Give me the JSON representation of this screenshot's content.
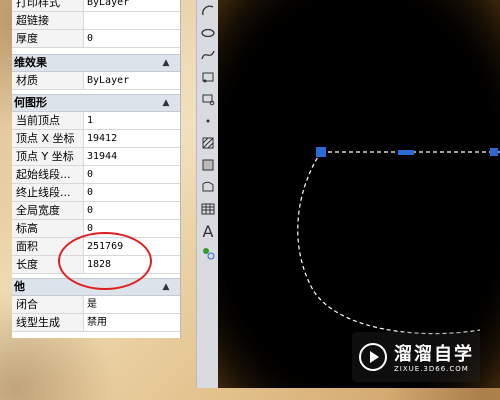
{
  "properties_panel": {
    "rows_top": [
      {
        "label": "打印样式",
        "value": "ByLayer",
        "label_display": "打印样式"
      },
      {
        "label": "超链接",
        "value": ""
      },
      {
        "label": "厚度",
        "value": "0"
      }
    ],
    "section_3d": {
      "title": "三维效果",
      "title_display": "维效果",
      "rows": [
        {
          "label": "材质",
          "value": "ByLayer"
        }
      ]
    },
    "section_geometry": {
      "title": "几何图形",
      "title_display": "何图形",
      "rows": [
        {
          "label": "当前顶点",
          "value": "1"
        },
        {
          "label": "顶点 X 坐标",
          "value": "19412"
        },
        {
          "label": "顶点 Y 坐标",
          "value": "31944"
        },
        {
          "label": "起始线段...",
          "value": "0"
        },
        {
          "label": "终止线段...",
          "value": "0"
        },
        {
          "label": "全局宽度",
          "value": "0"
        },
        {
          "label": "标高",
          "value": "0"
        },
        {
          "label": "面积",
          "value": "251769"
        },
        {
          "label": "长度",
          "value": "1828"
        }
      ]
    },
    "section_other": {
      "title": "其他",
      "title_display": "他",
      "rows": [
        {
          "label": "闭合",
          "value": "是"
        },
        {
          "label": "线型生成",
          "value": "禁用"
        }
      ]
    }
  },
  "toolbar": {
    "tools": [
      "arc-icon",
      "ellipse-icon",
      "spline-icon",
      "insert-block-icon",
      "make-block-icon",
      "point-icon",
      "hatch-icon",
      "gradient-icon",
      "region-icon",
      "table-icon",
      "text-icon",
      "add-selected-icon"
    ]
  },
  "watermark": {
    "title": "溜溜自学",
    "subtitle": "ZIXUE.3D66.COM"
  },
  "colors": {
    "canvas": "#000000",
    "grip": "#2a6ad6",
    "highlight": "#e02020"
  }
}
